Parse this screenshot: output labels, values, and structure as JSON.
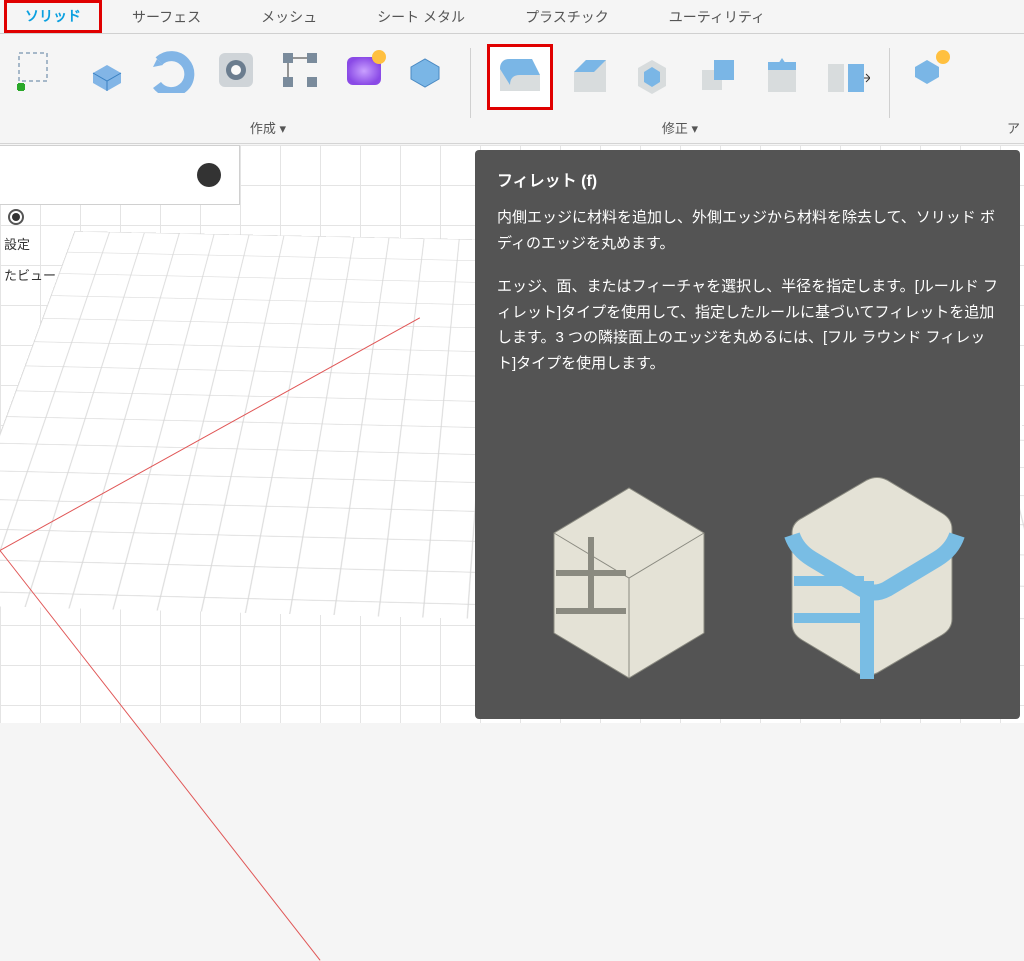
{
  "tabs": {
    "solid": "ソリッド",
    "surface": "サーフェス",
    "mesh": "メッシュ",
    "sheet": "シート メタル",
    "plastic": "プラスチック",
    "utility": "ユーティリティ"
  },
  "groups": {
    "create": "作成 ▾",
    "modify": "修正 ▾"
  },
  "right_label": "ア",
  "side": {
    "clear_label": "",
    "setting": "設定",
    "view": "たビュー"
  },
  "tooltip": {
    "title": "フィレット (f)",
    "desc1": "内側エッジに材料を追加し、外側エッジから材料を除去して、ソリッド ボディのエッジを丸めます。",
    "desc2": "エッジ、面、またはフィーチャを選択し、半径を指定します。[ルールド フィレット]タイプを使用して、指定したルールに基づいてフィレットを追加します。3 つの隣接面上のエッジを丸めるには、[フル ラウンド フィレット]タイプを使用します。"
  }
}
